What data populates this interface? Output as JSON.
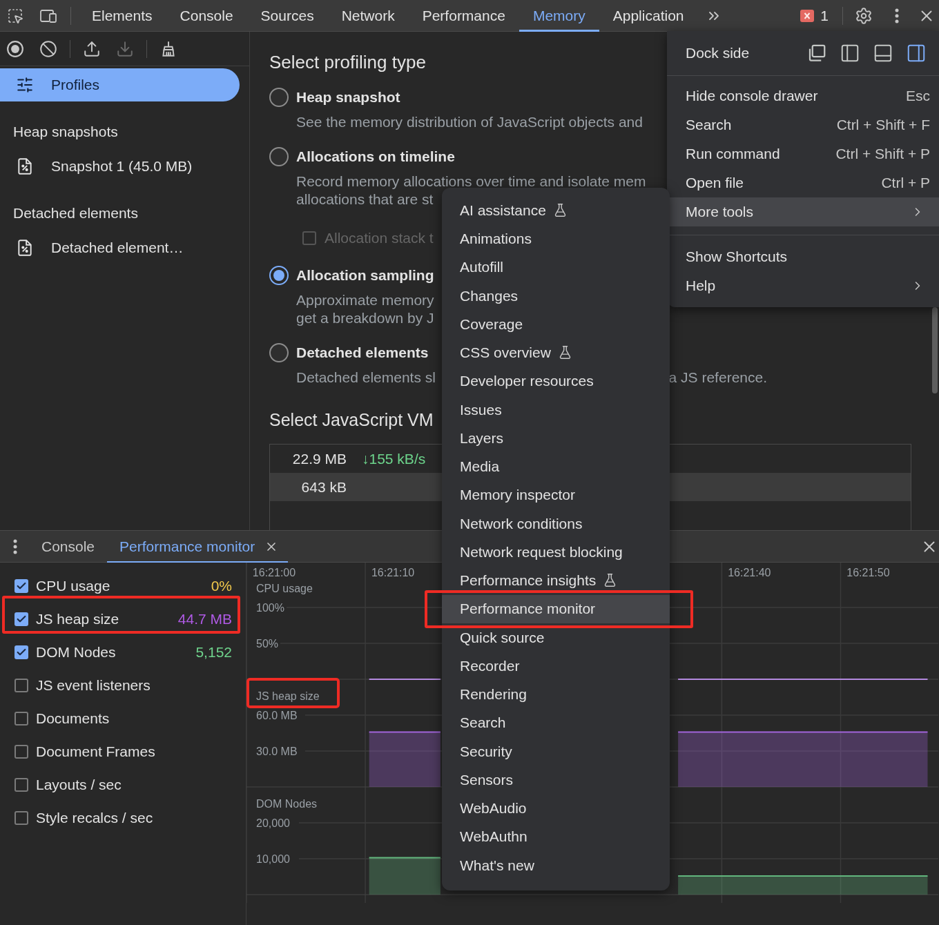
{
  "toolbar": {
    "tabs": [
      {
        "label": "Elements",
        "selected": false
      },
      {
        "label": "Console",
        "selected": false
      },
      {
        "label": "Sources",
        "selected": false
      },
      {
        "label": "Network",
        "selected": false
      },
      {
        "label": "Performance",
        "selected": false
      },
      {
        "label": "Memory",
        "selected": true
      },
      {
        "label": "Application",
        "selected": false
      }
    ],
    "error_count": "1"
  },
  "sidebar": {
    "action_groups": [
      [
        {
          "kind": "record",
          "disabled": false
        },
        {
          "kind": "clear",
          "disabled": false
        }
      ],
      [
        {
          "kind": "load",
          "disabled": false
        },
        {
          "kind": "save",
          "disabled": true
        }
      ],
      [
        {
          "kind": "collect_garbage",
          "disabled": false
        }
      ]
    ],
    "profiles": {
      "label": "Profiles",
      "selected": true
    },
    "groups": [
      {
        "heading": "Heap snapshots",
        "items": [
          {
            "label": "Snapshot 1 (45.0 MB)"
          }
        ]
      },
      {
        "heading": "Detached elements",
        "items": [
          {
            "label": "Detached element…"
          }
        ]
      }
    ]
  },
  "profiling": {
    "title": "Select profiling type",
    "options": [
      {
        "label": "Heap snapshot",
        "selected": false,
        "description": [
          [
            "See the memory distribution of JavaScript objects and"
          ]
        ]
      },
      {
        "label": "Allocations on timeline",
        "selected": false,
        "description": [
          [
            "Record memory allocations over time and isolate mem"
          ],
          [
            "allocations that are st"
          ]
        ],
        "checkbox": {
          "label": "Allocation stack t",
          "checked": false,
          "disabled": true
        }
      },
      {
        "label": "Allocation sampling",
        "selected": true,
        "description": [
          [
            "Approximate memory"
          ],
          [
            "get a breakdown by J"
          ]
        ]
      },
      {
        "label": "Detached elements",
        "selected": false,
        "description": [
          [
            "Detached elements sl",
            "a JS reference."
          ]
        ]
      }
    ],
    "vm_title": "Select JavaScript VM",
    "vm_rows": [
      {
        "selected": false,
        "cells": [
          {
            "kind": "size",
            "text": "22.9 MB"
          },
          {
            "kind": "rate",
            "text": "↓155 kB/s"
          }
        ]
      },
      {
        "selected": true,
        "cells": [
          {
            "kind": "size",
            "text": "643 kB"
          }
        ]
      }
    ]
  },
  "dock_menu": {
    "dock_side": {
      "label": "Dock side",
      "options": [
        {
          "kind": "undock",
          "selected": false
        },
        {
          "kind": "left",
          "selected": false
        },
        {
          "kind": "bottom",
          "selected": false
        },
        {
          "kind": "right",
          "selected": true
        }
      ]
    },
    "sections": [
      {
        "items": [
          {
            "label": "Hide console drawer",
            "shortcut": "Esc",
            "submenu": false,
            "highlighted": false
          },
          {
            "label": "Search",
            "shortcut": "Ctrl + Shift + F",
            "submenu": false,
            "highlighted": false
          },
          {
            "label": "Run command",
            "shortcut": "Ctrl + Shift + P",
            "submenu": false,
            "highlighted": false
          },
          {
            "label": "Open file",
            "shortcut": "Ctrl + P",
            "submenu": false,
            "highlighted": false
          },
          {
            "label": "More tools",
            "submenu": true,
            "highlighted": true
          }
        ]
      },
      {
        "items": [
          {
            "label": "Show Shortcuts",
            "submenu": false,
            "highlighted": false
          },
          {
            "label": "Help",
            "submenu": true,
            "highlighted": false
          }
        ]
      }
    ]
  },
  "more_tools_menu": {
    "items": [
      {
        "label": "AI assistance",
        "experimental": true,
        "highlighted": false,
        "annotated": false
      },
      {
        "label": "Animations",
        "experimental": false,
        "highlighted": false,
        "annotated": false
      },
      {
        "label": "Autofill",
        "experimental": false,
        "highlighted": false,
        "annotated": false
      },
      {
        "label": "Changes",
        "experimental": false,
        "highlighted": false,
        "annotated": false
      },
      {
        "label": "Coverage",
        "experimental": false,
        "highlighted": false,
        "annotated": false
      },
      {
        "label": "CSS overview",
        "experimental": true,
        "highlighted": false,
        "annotated": false
      },
      {
        "label": "Developer resources",
        "experimental": false,
        "highlighted": false,
        "annotated": false
      },
      {
        "label": "Issues",
        "experimental": false,
        "highlighted": false,
        "annotated": false
      },
      {
        "label": "Layers",
        "experimental": false,
        "highlighted": false,
        "annotated": false
      },
      {
        "label": "Media",
        "experimental": false,
        "highlighted": false,
        "annotated": false
      },
      {
        "label": "Memory inspector",
        "experimental": false,
        "highlighted": false,
        "annotated": false
      },
      {
        "label": "Network conditions",
        "experimental": false,
        "highlighted": false,
        "annotated": false
      },
      {
        "label": "Network request blocking",
        "experimental": false,
        "highlighted": false,
        "annotated": false
      },
      {
        "label": "Performance insights",
        "experimental": true,
        "highlighted": false,
        "annotated": false
      },
      {
        "label": "Performance monitor",
        "experimental": false,
        "highlighted": true,
        "annotated": true
      },
      {
        "label": "Quick source",
        "experimental": false,
        "highlighted": false,
        "annotated": false
      },
      {
        "label": "Recorder",
        "experimental": false,
        "highlighted": false,
        "annotated": false
      },
      {
        "label": "Rendering",
        "experimental": false,
        "highlighted": false,
        "annotated": false
      },
      {
        "label": "Search",
        "experimental": false,
        "highlighted": false,
        "annotated": false
      },
      {
        "label": "Security",
        "experimental": false,
        "highlighted": false,
        "annotated": false
      },
      {
        "label": "Sensors",
        "experimental": false,
        "highlighted": false,
        "annotated": false
      },
      {
        "label": "WebAudio",
        "experimental": false,
        "highlighted": false,
        "annotated": false
      },
      {
        "label": "WebAuthn",
        "experimental": false,
        "highlighted": false,
        "annotated": false
      },
      {
        "label": "What's new",
        "experimental": false,
        "highlighted": false,
        "annotated": false
      }
    ]
  },
  "drawer": {
    "tabs": [
      {
        "label": "Console",
        "selected": false,
        "closable": false
      },
      {
        "label": "Performance monitor",
        "selected": true,
        "closable": true
      }
    ],
    "metrics": [
      {
        "label": "CPU usage",
        "checked": true,
        "value": "0%",
        "color": "#f2c94c",
        "annotated": false
      },
      {
        "label": "JS heap size",
        "checked": true,
        "value": "44.7 MB",
        "color": "#b05ae6",
        "annotated": true
      },
      {
        "label": "DOM Nodes",
        "checked": true,
        "value": "5,152",
        "color": "#6fd38c",
        "annotated": false
      },
      {
        "label": "JS event listeners",
        "checked": false,
        "annotated": false
      },
      {
        "label": "Documents",
        "checked": false,
        "annotated": false
      },
      {
        "label": "Document Frames",
        "checked": false,
        "annotated": false
      },
      {
        "label": "Layouts / sec",
        "checked": false,
        "annotated": false
      },
      {
        "label": "Style recalcs / sec",
        "checked": false,
        "annotated": false
      }
    ],
    "charts": [
      {
        "annotated": false,
        "chart_data": {
          "type": "line",
          "title": "CPU usage",
          "categories": [
            "16:21:00",
            null,
            null,
            null,
            null,
            null,
            null,
            null,
            null,
            null,
            "16:21:10",
            null,
            null,
            null,
            null,
            null,
            null,
            null,
            null,
            null,
            null,
            null,
            null,
            null,
            null,
            null,
            null,
            null,
            null,
            null,
            null,
            null,
            null,
            null,
            null,
            null,
            null,
            null,
            null,
            null,
            "16:21:40",
            null,
            null,
            null,
            null,
            null,
            null,
            null,
            null,
            null,
            "16:21:50",
            null,
            null,
            null,
            null,
            null
          ],
          "series": [
            {
              "color": "#b48ae0",
              "values": [
                null,
                null,
                null,
                null,
                null,
                null,
                null,
                null,
                0,
                0,
                0,
                0,
                0,
                0,
                0,
                null,
                null,
                null,
                null,
                null,
                null,
                null,
                null,
                null,
                null,
                null,
                null,
                null,
                null,
                null,
                null,
                null,
                null,
                null,
                0,
                0,
                0,
                0,
                0,
                0,
                0,
                0,
                0,
                0,
                0,
                0,
                0,
                0,
                0,
                0,
                0,
                0,
                0,
                0,
                0,
                0
              ]
            }
          ],
          "ylim": [
            0,
            100
          ],
          "yticks": [
            {
              "value": 100,
              "label": "100%"
            },
            {
              "value": 50,
              "label": "50%"
            }
          ]
        }
      },
      {
        "annotated": true,
        "chart_data": {
          "type": "area",
          "title": "JS heap size",
          "categories": [
            null,
            null,
            null,
            null,
            null,
            null,
            null,
            null,
            null,
            null,
            null,
            null,
            null,
            null,
            null,
            null,
            null,
            null,
            null,
            null,
            null,
            null,
            null,
            null,
            null,
            null,
            null,
            null,
            null,
            null,
            null,
            null,
            null,
            null,
            null,
            null,
            null,
            null,
            null,
            null,
            null,
            null,
            null,
            null,
            null,
            null,
            null,
            null,
            null,
            null,
            null,
            null,
            null,
            null,
            null,
            null
          ],
          "series": [
            {
              "color": "#a265dc",
              "values": [
                null,
                null,
                null,
                null,
                null,
                null,
                null,
                null,
                45.8,
                45.8,
                45.8,
                45.8,
                45.8,
                45.8,
                45.8,
                null,
                null,
                null,
                null,
                null,
                null,
                null,
                null,
                null,
                null,
                null,
                null,
                null,
                null,
                null,
                null,
                null,
                null,
                null,
                45.8,
                45.8,
                45.8,
                45.8,
                45.8,
                45.8,
                45.8,
                45.8,
                45.8,
                45.8,
                45.8,
                45.8,
                45.8,
                45.8,
                45.8,
                45.8,
                45.8,
                45.8,
                45.8,
                45.8,
                45.8,
                45.8
              ]
            }
          ],
          "ylim": [
            0,
            60
          ],
          "yticks": [
            {
              "value": 60,
              "label": "60.0 MB"
            },
            {
              "value": 30,
              "label": "30.0 MB"
            }
          ]
        }
      },
      {
        "annotated": false,
        "chart_data": {
          "type": "area",
          "title": "DOM Nodes",
          "categories": [
            null,
            null,
            null,
            null,
            null,
            null,
            null,
            null,
            null,
            null,
            null,
            null,
            null,
            null,
            null,
            null,
            null,
            null,
            null,
            null,
            null,
            null,
            null,
            null,
            null,
            null,
            null,
            null,
            null,
            null,
            null,
            null,
            null,
            null,
            null,
            null,
            null,
            null,
            null,
            null,
            null,
            null,
            null,
            null,
            null,
            null,
            null,
            null,
            null,
            null,
            null,
            null,
            null,
            null,
            null,
            null
          ],
          "series": [
            {
              "color": "#62b77e",
              "values": [
                null,
                null,
                null,
                null,
                null,
                null,
                null,
                null,
                10300,
                10300,
                10300,
                10300,
                10300,
                10300,
                10300,
                null,
                null,
                null,
                null,
                null,
                null,
                null,
                null,
                null,
                null,
                null,
                null,
                null,
                null,
                null,
                null,
                null,
                null,
                null,
                5200,
                5200,
                5200,
                5200,
                5200,
                5200,
                5200,
                5200,
                5200,
                5200,
                5200,
                5200,
                5200,
                5200,
                5200,
                5200,
                5200,
                5200,
                5200,
                5200,
                5200,
                5200
              ]
            }
          ],
          "ylim": [
            0,
            20000
          ],
          "yticks": [
            {
              "value": 20000,
              "label": "20,000"
            },
            {
              "value": 10000,
              "label": "10,000"
            }
          ]
        }
      }
    ]
  }
}
